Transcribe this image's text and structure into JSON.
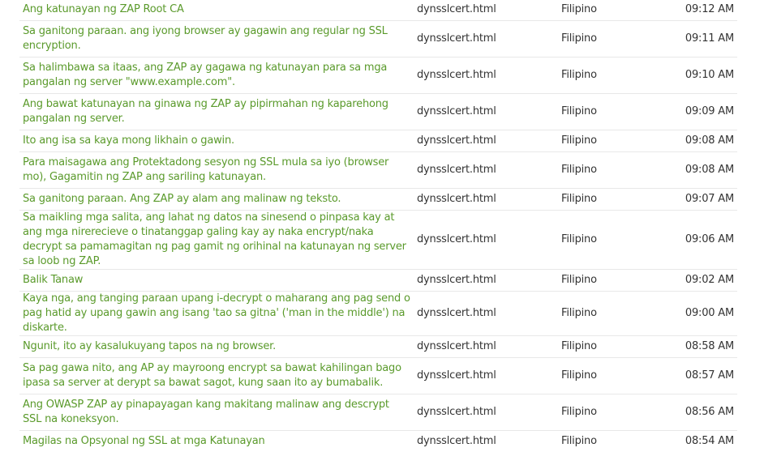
{
  "rows": [
    {
      "text": "Ang katunayan ng ZAP Root CA",
      "file": "dynsslcert.html",
      "language": "Filipino",
      "time": "09:12 AM"
    },
    {
      "text": "Sa ganitong paraan. ang iyong browser ay gagawin ang regular ng SSL encryption.",
      "file": "dynsslcert.html",
      "language": "Filipino",
      "time": "09:11 AM"
    },
    {
      "text": "Sa halimbawa sa itaas, ang ZAP ay gagawa ng katunayan para sa mga pangalan ng server \"www.example.com\".",
      "file": "dynsslcert.html",
      "language": "Filipino",
      "time": "09:10 AM"
    },
    {
      "text": "Ang bawat katunayan na ginawa ng ZAP ay pipirmahan ng kaparehong pangalan ng server.",
      "file": "dynsslcert.html",
      "language": "Filipino",
      "time": "09:09 AM"
    },
    {
      "text": "Ito ang isa sa kaya mong likhain o gawin.",
      "file": "dynsslcert.html",
      "language": "Filipino",
      "time": "09:08 AM"
    },
    {
      "text": "Para maisagawa ang Protektadong sesyon ng SSL mula sa iyo (browser mo), Gagamitin ng ZAP ang sariling katunayan.",
      "file": "dynsslcert.html",
      "language": "Filipino",
      "time": "09:08 AM"
    },
    {
      "text": "Sa ganitong paraan. Ang ZAP ay alam ang malinaw ng teksto.",
      "file": "dynsslcert.html",
      "language": "Filipino",
      "time": "09:07 AM"
    },
    {
      "text": "Sa maikling mga salita, ang lahat ng datos na sinesend o pinpasa kay at ang mga nirerecieve o tinatanggap galing kay ay naka encrypt/naka decrypt sa pamamagitan ng pag gamit ng orihinal na katunayan ng server sa loob ng ZAP.",
      "file": "dynsslcert.html",
      "language": "Filipino",
      "time": "09:06 AM"
    },
    {
      "text": "Balik Tanaw",
      "file": "dynsslcert.html",
      "language": "Filipino",
      "time": "09:02 AM"
    },
    {
      "text": "Kaya nga, ang tanging paraan upang i-decrypt o maharang ang pag send o pag hatid ay upang gawin ang isang 'tao sa gitna' ('man in the middle') na diskarte.",
      "file": "dynsslcert.html",
      "language": "Filipino",
      "time": "09:00 AM"
    },
    {
      "text": "Ngunit, ito ay kasalukuyang tapos na ng browser.",
      "file": "dynsslcert.html",
      "language": "Filipino",
      "time": "08:58 AM"
    },
    {
      "text": "Sa pag gawa nito, ang AP ay mayroong encrypt sa bawat kahilingan bago ipasa sa server at derypt sa bawat sagot, kung saan ito ay bumabalik.",
      "file": "dynsslcert.html",
      "language": "Filipino",
      "time": "08:57 AM"
    },
    {
      "text": "Ang OWASP ZAP ay pinapayagan kang makitang malinaw ang descrypt SSL na koneksyon.",
      "file": "dynsslcert.html",
      "language": "Filipino",
      "time": "08:56 AM"
    },
    {
      "text": "Magilas na Opsyonal ng SSL at mga Katunayan",
      "file": "dynsslcert.html",
      "language": "Filipino",
      "time": "08:54 AM"
    }
  ]
}
